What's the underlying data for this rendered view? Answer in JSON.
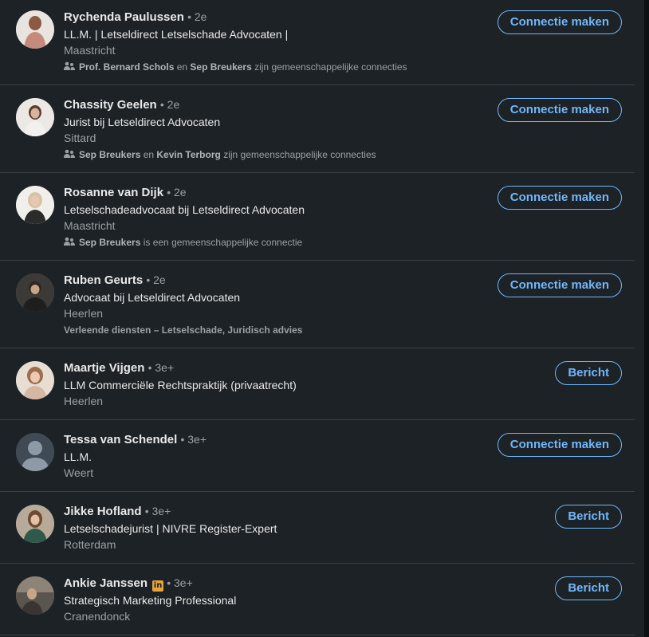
{
  "results": [
    {
      "name": "Rychenda Paulussen",
      "degree": "• 2e",
      "headline": "LL.M. | Letseldirect Letselschade Advocaten |",
      "location": "Maastricht",
      "meta_bold1": "Prof. Bernard Schols",
      "meta_mid": " en ",
      "meta_bold2": "Sep Breukers",
      "meta_tail": " zijn gemeenschappelijke connecties",
      "button": "Connectie maken",
      "avatar_color": "#b98a7a"
    },
    {
      "name": "Chassity Geelen",
      "degree": "• 2e",
      "headline": "Jurist bij Letseldirect Advocaten",
      "location": "Sittard",
      "meta_bold1": "Sep Breukers",
      "meta_mid": " en ",
      "meta_bold2": "Kevin Terborg",
      "meta_tail": " zijn gemeenschappelijke connecties",
      "button": "Connectie maken",
      "avatar_color": "#d9d2cb"
    },
    {
      "name": "Rosanne van Dijk",
      "degree": "• 2e",
      "headline": "Letselschadeadvocaat bij Letseldirect Advocaten",
      "location": "Maastricht",
      "meta_bold1": "Sep Breukers",
      "meta_tail": " is een gemeenschappelijke connectie",
      "button": "Connectie maken",
      "avatar_color": "#e4e1dc"
    },
    {
      "name": "Ruben Geurts",
      "degree": "• 2e",
      "headline": "Advocaat bij Letseldirect Advocaten",
      "location": "Heerlen",
      "services": "Verleende diensten – Letselschade, Juridisch advies",
      "button": "Connectie maken",
      "avatar_color": "#6e6a64"
    },
    {
      "name": "Maartje Vijgen",
      "degree": "• 3e+",
      "headline": "LLM Commerciële Rechtspraktijk (privaatrecht)",
      "location": "Heerlen",
      "button": "Bericht",
      "avatar_color": "#c9a890"
    },
    {
      "name": "Tessa van Schendel",
      "degree": "• 3e+",
      "headline": "LL.M.",
      "location": "Weert",
      "button": "Connectie maken",
      "avatar_color": "#56687a"
    },
    {
      "name": "Jikke Hofland",
      "degree": "• 3e+",
      "headline": "Letselschadejurist | NIVRE Register-Expert",
      "location": "Rotterdam",
      "button": "Bericht",
      "avatar_color": "#a08a72"
    },
    {
      "name": "Ankie Janssen",
      "degree": "• 3e+",
      "badge": "in",
      "headline": "Strategisch Marketing Professional",
      "location": "Cranendonck",
      "button": "Bericht",
      "avatar_color": "#7a756e"
    }
  ]
}
